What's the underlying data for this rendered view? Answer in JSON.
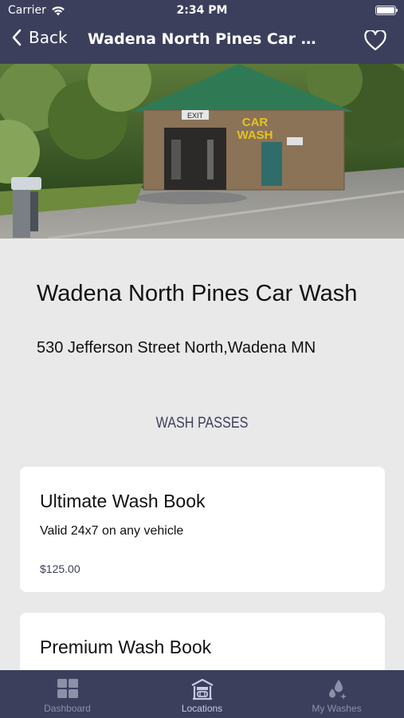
{
  "status_bar": {
    "carrier": "Carrier",
    "time": "2:34 PM",
    "battery_level": 1.0
  },
  "nav": {
    "back_label": "Back",
    "title": "Wadena North Pines Car Wa...",
    "favorite_icon": "heart-icon"
  },
  "hero": {
    "sign_exit": "EXIT",
    "sign_car": "CAR",
    "sign_wash": "WASH"
  },
  "location": {
    "name": "Wadena North Pines Car Wash",
    "address": "530 Jefferson Street North,Wadena MN"
  },
  "section": {
    "title": "WASH PASSES"
  },
  "passes": [
    {
      "title": "Ultimate Wash Book",
      "description": "Valid 24x7 on any vehicle",
      "price": "$125.00"
    },
    {
      "title": "Premium Wash Book"
    }
  ],
  "tabbar": {
    "tabs": [
      {
        "label": "Dashboard",
        "icon": "grid-icon",
        "active": false
      },
      {
        "label": "Locations",
        "icon": "car-wash-building-icon",
        "active": true
      },
      {
        "label": "My Washes",
        "icon": "water-drops-icon",
        "active": false
      }
    ]
  },
  "colors": {
    "primary": "#3c3f5c",
    "background": "#e9e9e9",
    "card": "#ffffff",
    "tab_inactive": "#8d90a6",
    "tab_active": "#c8cbe4"
  }
}
